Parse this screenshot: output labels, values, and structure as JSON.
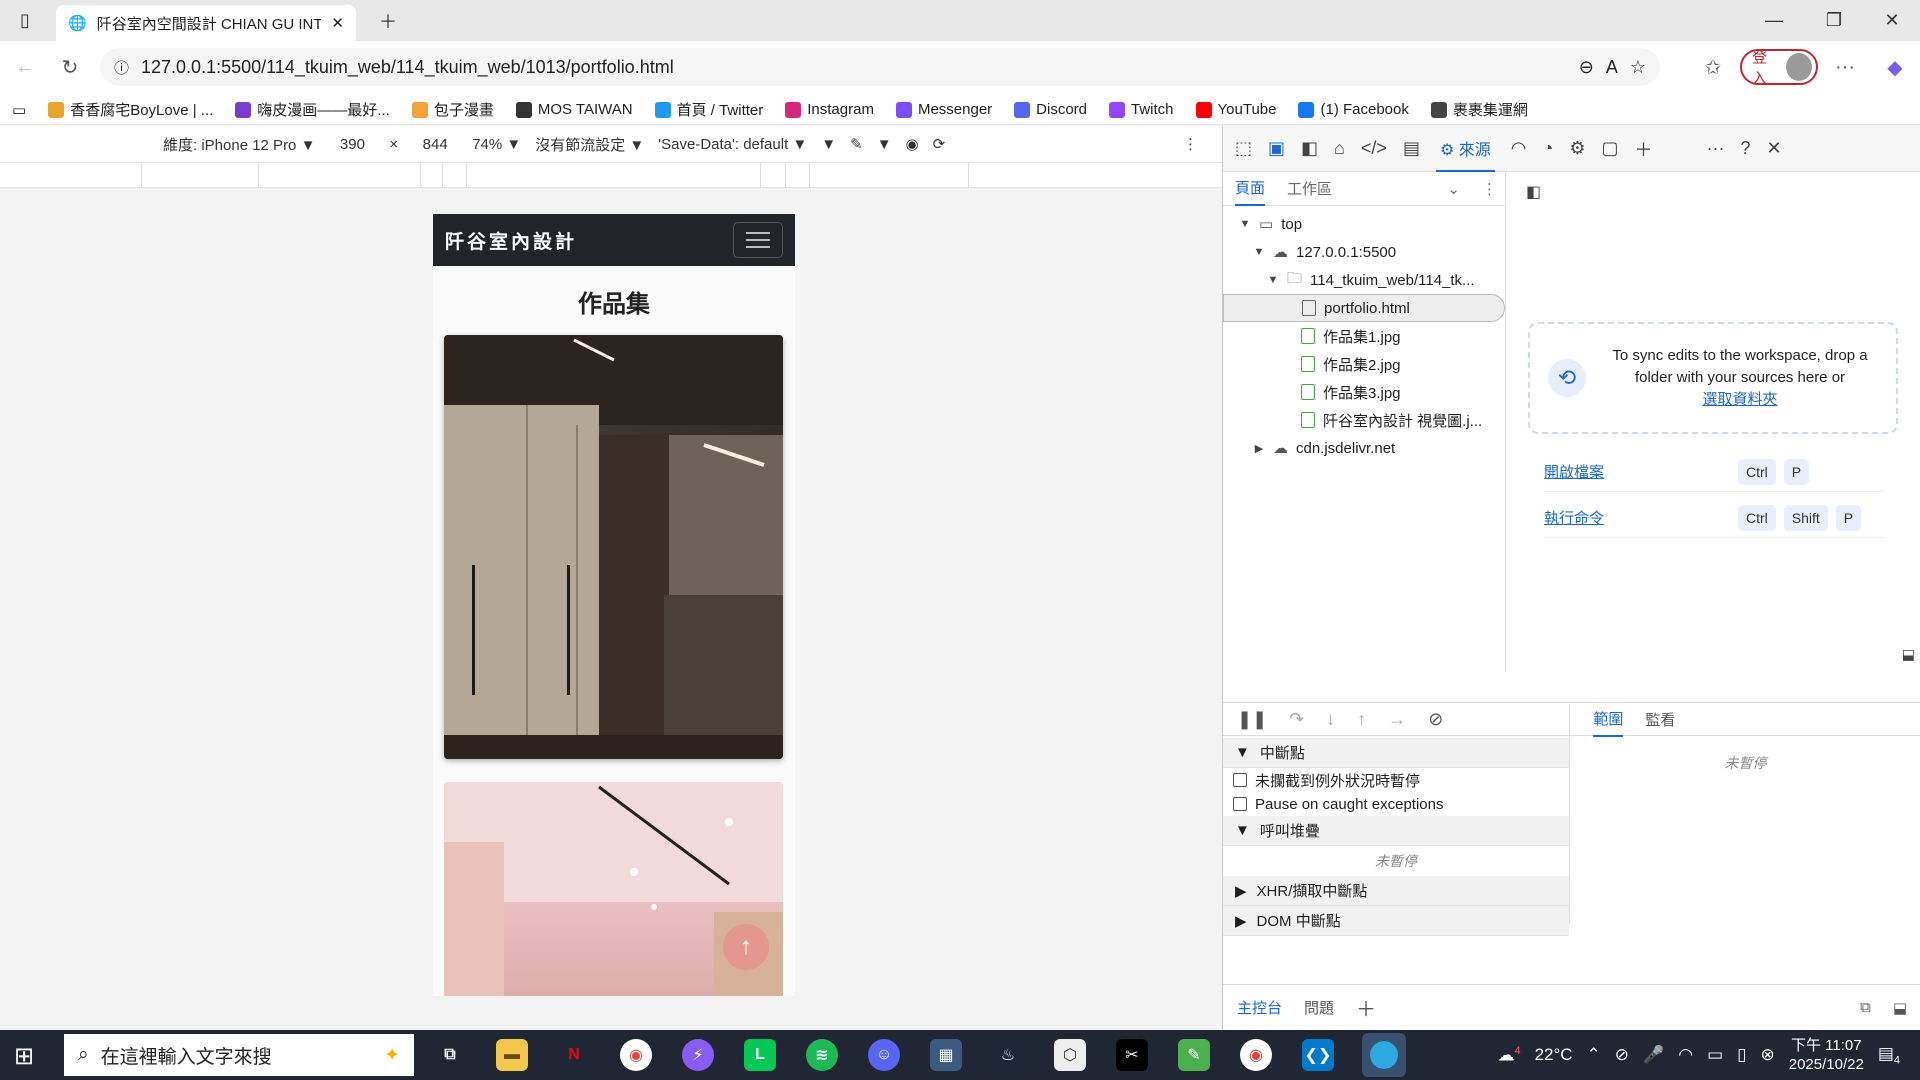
{
  "browser": {
    "tab_title": "阡谷室內空間設計 CHIAN GU INT",
    "url": "127.0.0.1:5500/114_tkuim_web/114_tkuim_web/1013/portfolio.html",
    "login_label": "登入",
    "bookmarks": [
      {
        "label": "香香腐宅BoyLove | ...",
        "color": "#e6a52b"
      },
      {
        "label": "嗨皮漫画——最好...",
        "color": "#7a3bd1"
      },
      {
        "label": "包子漫畫",
        "color": "#f2a23a"
      },
      {
        "label": "MOS TAIWAN",
        "color": "#333333"
      },
      {
        "label": "首頁 / Twitter",
        "color": "#1d9bf0"
      },
      {
        "label": "Instagram",
        "color": "#d6287a"
      },
      {
        "label": "Messenger",
        "color": "#7d4ef2"
      },
      {
        "label": "Discord",
        "color": "#5865f2"
      },
      {
        "label": "Twitch",
        "color": "#9146ff"
      },
      {
        "label": "YouTube",
        "color": "#ff0000"
      },
      {
        "label": "(1) Facebook",
        "color": "#1877f2"
      },
      {
        "label": "裹裹集運網",
        "color": "#444444"
      }
    ]
  },
  "emulation": {
    "device": "維度: iPhone 12 Pro",
    "width": "390",
    "times": "×",
    "height": "844",
    "zoom": "74%",
    "throttle": "沒有節流設定",
    "save_data": "'Save-Data': default"
  },
  "page": {
    "brand": "阡谷室內設計",
    "heading": "作品集"
  },
  "devtools": {
    "active_tool": "來源",
    "nav_tab_page": "頁面",
    "nav_tab_workspace": "工作區",
    "tree": [
      {
        "label": "top",
        "indent": 0,
        "toggle": "▼",
        "icon": "window"
      },
      {
        "label": "127.0.0.1:5500",
        "indent": 1,
        "toggle": "▼",
        "icon": "cloud"
      },
      {
        "label": "114_tkuim_web/114_tk...",
        "indent": 2,
        "toggle": "▼",
        "icon": "folder"
      },
      {
        "label": "portfolio.html",
        "indent": 3,
        "toggle": "",
        "icon": "doc",
        "selected": true
      },
      {
        "label": "作品集1.jpg",
        "indent": 3,
        "toggle": "",
        "icon": "file"
      },
      {
        "label": "作品集2.jpg",
        "indent": 3,
        "toggle": "",
        "icon": "file"
      },
      {
        "label": "作品集3.jpg",
        "indent": 3,
        "toggle": "",
        "icon": "file"
      },
      {
        "label": "阡谷室內設計 視覺圖.j...",
        "indent": 3,
        "toggle": "",
        "icon": "file"
      },
      {
        "label": "cdn.jsdelivr.net",
        "indent": 1,
        "toggle": "▶",
        "icon": "cloud"
      }
    ],
    "sync_text": "To sync edits to the workspace, drop a folder with your sources here or",
    "sync_link": "選取資料夾",
    "shortcut_open_file": "開啟檔案",
    "shortcut_run_cmd": "執行命令",
    "key_ctrl": "Ctrl",
    "key_shift": "Shift",
    "key_p": "P",
    "breakpoints_title": "中斷點",
    "pause_uncaught": "未攔截到例外狀況時暫停",
    "pause_caught": "Pause on caught exceptions",
    "call_stack_title": "呼叫堆疊",
    "not_paused": "未暫停",
    "xhr_title": "XHR/擷取中斷點",
    "dom_title": "DOM 中斷點",
    "scope_tab": "範圍",
    "watch_tab": "監看",
    "drawer_console": "主控台",
    "drawer_issues": "問題"
  },
  "taskbar": {
    "search_placeholder": "在這裡輸入文字來搜",
    "weather_badge": "4",
    "temperature": "22°C",
    "time": "下午 11:07",
    "date": "2025/10/22",
    "notification_count": "4"
  }
}
